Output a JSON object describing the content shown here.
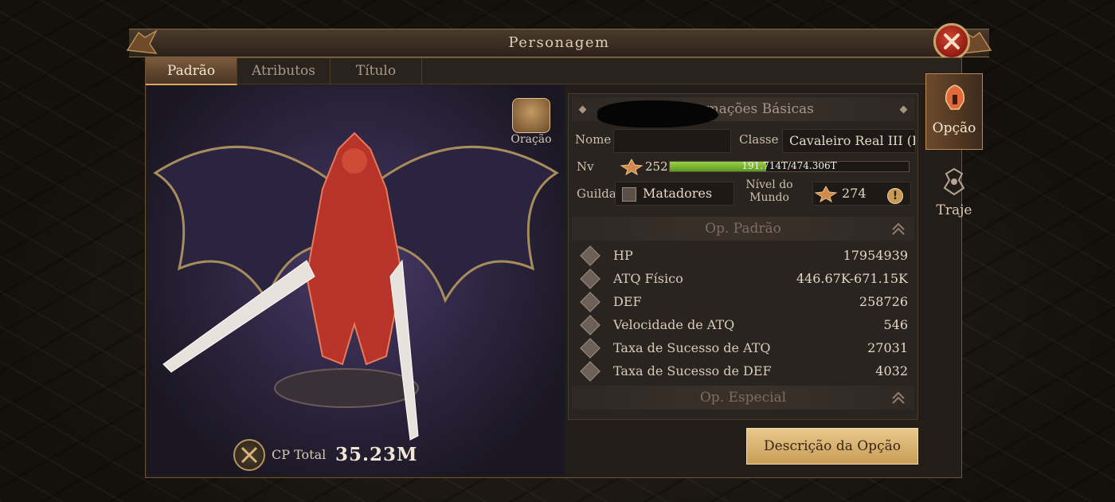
{
  "window": {
    "title": "Personagem"
  },
  "tabs": [
    {
      "label": "Padrão",
      "active": true
    },
    {
      "label": "Atributos",
      "active": false
    },
    {
      "label": "Título",
      "active": false
    }
  ],
  "character": {
    "oracao_label": "Oração",
    "cp_label": "CP Total",
    "cp_value": "35.23M"
  },
  "basic_info": {
    "header": "Informações Básicas",
    "name_label": "Nome",
    "name_value": "",
    "class_label": "Classe",
    "class_value": "Cavaleiro Real III (FOR)",
    "level_label": "Nv",
    "level_value": "252",
    "xp_text": "191.714T/474.306T",
    "xp_fraction": 0.404,
    "guild_label": "Guilda",
    "guild_value": "Matadores",
    "world_level_label_line1": "Nível do",
    "world_level_label_line2": "Mundo",
    "world_level_value": "274"
  },
  "op_padrao": {
    "header": "Op. Padrão",
    "stats": [
      {
        "name": "HP",
        "value": "17954939"
      },
      {
        "name": "ATQ Físico",
        "value": "446.67K-671.15K"
      },
      {
        "name": "DEF",
        "value": "258726"
      },
      {
        "name": "Velocidade de ATQ",
        "value": "546"
      },
      {
        "name": "Taxa de Sucesso de ATQ",
        "value": "27031"
      },
      {
        "name": "Taxa de Sucesso de DEF",
        "value": "4032"
      }
    ]
  },
  "op_especial": {
    "header": "Op. Especial"
  },
  "description_button": "Descrição da Opção",
  "side_tabs": [
    {
      "label": "Opção",
      "active": true,
      "icon": "helmet-icon"
    },
    {
      "label": "Traje",
      "active": false,
      "icon": "costume-icon"
    }
  ],
  "colors": {
    "accent_gold": "#d9a760",
    "xp_green": "#7cbf2f",
    "close_red": "#b52d21"
  }
}
